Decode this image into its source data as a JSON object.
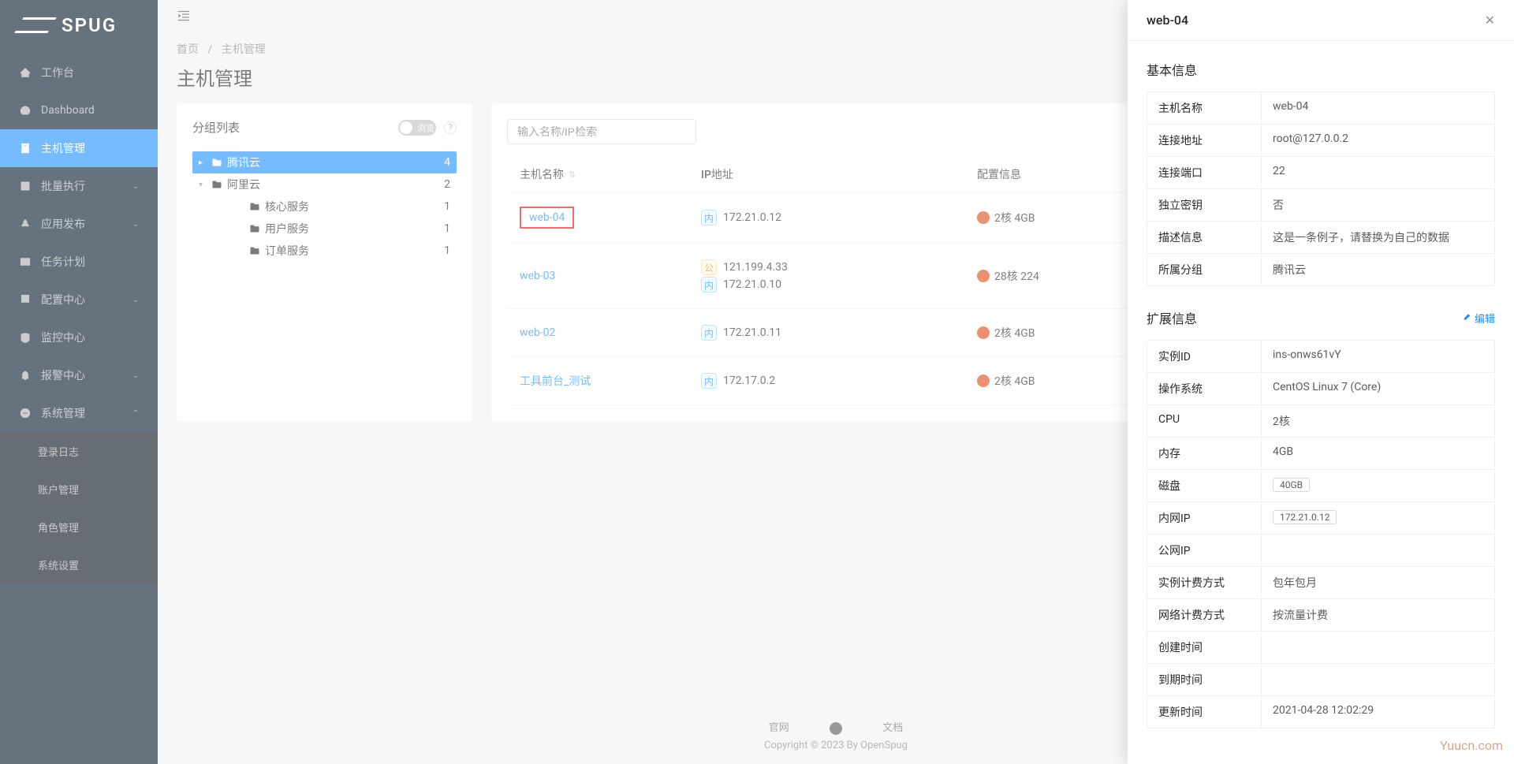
{
  "logo": "SPUG",
  "menu": [
    {
      "icon": "home",
      "label": "工作台"
    },
    {
      "icon": "dashboard",
      "label": "Dashboard"
    },
    {
      "icon": "host",
      "label": "主机管理",
      "active": true
    },
    {
      "icon": "batch",
      "label": "批量执行",
      "caret": true
    },
    {
      "icon": "deploy",
      "label": "应用发布",
      "caret": true
    },
    {
      "icon": "task",
      "label": "任务计划"
    },
    {
      "icon": "config",
      "label": "配置中心",
      "caret": true
    },
    {
      "icon": "monitor",
      "label": "监控中心"
    },
    {
      "icon": "alarm",
      "label": "报警中心",
      "caret": true
    },
    {
      "icon": "system",
      "label": "系统管理",
      "expanded": true,
      "children": [
        {
          "label": "登录日志"
        },
        {
          "label": "账户管理"
        },
        {
          "label": "角色管理"
        },
        {
          "label": "系统设置"
        }
      ]
    }
  ],
  "breadcrumb": {
    "home": "首页",
    "current": "主机管理",
    "sep": "/"
  },
  "page_title": "主机管理",
  "group_card": {
    "title": "分组列表",
    "toggle_label": "浏览",
    "tree": [
      {
        "label": "腾讯云",
        "count": 4,
        "active": true,
        "indent": 0
      },
      {
        "label": "阿里云",
        "count": 2,
        "indent": 0,
        "caret": "down"
      },
      {
        "label": "核心服务",
        "count": 1,
        "indent": 2
      },
      {
        "label": "用户服务",
        "count": 1,
        "indent": 2
      },
      {
        "label": "订单服务",
        "count": 1,
        "indent": 2
      }
    ]
  },
  "host_card": {
    "search_placeholder": "输入名称/IP检索",
    "columns": {
      "name": "主机名称",
      "ip": "IP地址",
      "cfg": "配置信息"
    },
    "badge_nei": "内",
    "badge_gong": "公",
    "rows": [
      {
        "name": "web-04",
        "highlighted": true,
        "ips": [
          {
            "type": "nei",
            "addr": "172.21.0.12"
          }
        ],
        "cfg": "2核 4GB"
      },
      {
        "name": "web-03",
        "ips": [
          {
            "type": "gong",
            "addr": "121.199.4.33"
          },
          {
            "type": "nei",
            "addr": "172.21.0.10"
          }
        ],
        "cfg": "28核 224"
      },
      {
        "name": "web-02",
        "ips": [
          {
            "type": "nei",
            "addr": "172.21.0.11"
          }
        ],
        "cfg": "2核 4GB"
      },
      {
        "name": "工具前台_测试",
        "ips": [
          {
            "type": "nei",
            "addr": "172.17.0.2"
          }
        ],
        "cfg": "2核 4GB"
      }
    ]
  },
  "footer": {
    "links": {
      "site": "官网",
      "docs": "文档"
    },
    "copyright": "Copyright © 2023 By OpenSpug"
  },
  "drawer": {
    "title": "web-04",
    "basic_title": "基本信息",
    "basic": [
      {
        "k": "主机名称",
        "v": "web-04"
      },
      {
        "k": "连接地址",
        "v": "root@127.0.0.2"
      },
      {
        "k": "连接端口",
        "v": "22"
      },
      {
        "k": "独立密钥",
        "v": "否"
      },
      {
        "k": "描述信息",
        "v": "这是一条例子，请替换为自己的数据"
      },
      {
        "k": "所属分组",
        "v": "腾讯云"
      }
    ],
    "ext_title": "扩展信息",
    "edit_label": "编辑",
    "ext": [
      {
        "k": "实例ID",
        "v": "ins-onws61vY"
      },
      {
        "k": "操作系统",
        "v": "CentOS Linux 7 (Core)"
      },
      {
        "k": "CPU",
        "v": "2核"
      },
      {
        "k": "内存",
        "v": "4GB"
      },
      {
        "k": "磁盘",
        "v": "40GB",
        "tag": true
      },
      {
        "k": "内网IP",
        "v": "172.21.0.12",
        "tag": true
      },
      {
        "k": "公网IP",
        "v": ""
      },
      {
        "k": "实例计费方式",
        "v": "包年包月"
      },
      {
        "k": "网络计费方式",
        "v": "按流量计费"
      },
      {
        "k": "创建时间",
        "v": ""
      },
      {
        "k": "到期时间",
        "v": ""
      },
      {
        "k": "更新时间",
        "v": "2021-04-28 12:02:29"
      }
    ]
  },
  "watermark": "Yuucn.com"
}
